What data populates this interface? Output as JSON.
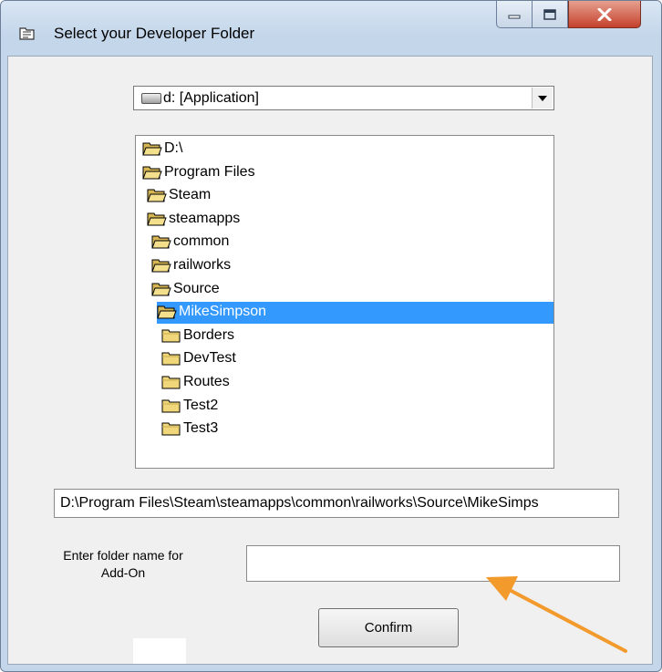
{
  "window": {
    "title": "Select your Developer Folder",
    "title_icon": "folder-tree-icon",
    "controls": [
      "minimize-icon",
      "maximize-icon",
      "close-icon"
    ]
  },
  "drive_select": {
    "selected": "d: [Application]",
    "icon": "drive-icon"
  },
  "folder_tree": {
    "items": [
      {
        "label": "D:\\",
        "depth": 0,
        "state": "open"
      },
      {
        "label": "Program Files",
        "depth": 0,
        "state": "open"
      },
      {
        "label": "Steam",
        "depth": 1,
        "state": "open"
      },
      {
        "label": "steamapps",
        "depth": 1,
        "state": "open"
      },
      {
        "label": "common",
        "depth": 2,
        "state": "open"
      },
      {
        "label": "railworks",
        "depth": 2,
        "state": "open"
      },
      {
        "label": "Source",
        "depth": 2,
        "state": "open"
      },
      {
        "label": "MikeSimpson",
        "depth": 3,
        "state": "open",
        "selected": true
      },
      {
        "label": "Borders",
        "depth": 4,
        "state": "closed"
      },
      {
        "label": "DevTest",
        "depth": 4,
        "state": "closed"
      },
      {
        "label": "Routes",
        "depth": 4,
        "state": "closed"
      },
      {
        "label": "Test2",
        "depth": 4,
        "state": "closed"
      },
      {
        "label": "Test3",
        "depth": 4,
        "state": "closed"
      }
    ]
  },
  "path": {
    "value": "D:\\Program Files\\Steam\\steamapps\\common\\railworks\\Source\\MikeSimps"
  },
  "folder_name": {
    "label_line1": "Enter folder name for",
    "label_line2": "Add-On",
    "value": ""
  },
  "confirm_button": {
    "label": "Confirm"
  },
  "colors": {
    "selection": "#3399ff",
    "arrow": "#f39a2c",
    "folder": "#f0d77a",
    "close_button": "#c4412c"
  }
}
